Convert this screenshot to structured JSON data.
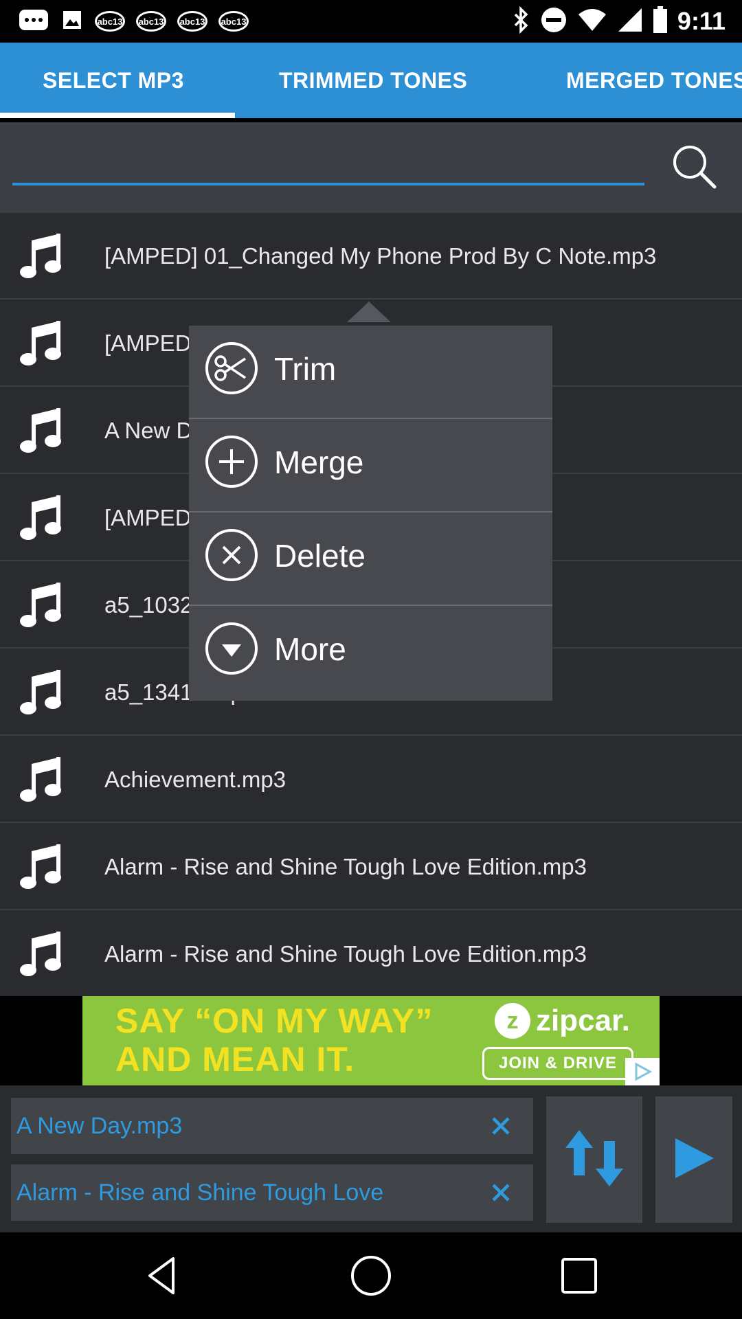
{
  "status_bar": {
    "time": "9:11",
    "channel_badge": "abc13",
    "icons": [
      "messages-icon",
      "photo-icon",
      "channel-icon",
      "bluetooth-icon",
      "dnd-icon",
      "wifi-icon",
      "signal-icon",
      "battery-icon"
    ]
  },
  "tabs": [
    {
      "label": "SELECT MP3",
      "selected": true
    },
    {
      "label": "TRIMMED TONES",
      "selected": false
    },
    {
      "label": "MERGED TONES",
      "selected": false
    }
  ],
  "search": {
    "value": "",
    "placeholder": "",
    "icon": "search-icon"
  },
  "files": [
    {
      "name": "[AMPED] 01_Changed My Phone Prod By C Note.mp3"
    },
    {
      "name": "[AMPED"
    },
    {
      "name": "A New D"
    },
    {
      "name": "[AMPED"
    },
    {
      "name": "a5_1032"
    },
    {
      "name": "a5_13413.mp3"
    },
    {
      "name": "Achievement.mp3"
    },
    {
      "name": "Alarm - Rise and Shine Tough Love Edition.mp3"
    },
    {
      "name": "Alarm - Rise and Shine Tough Love Edition.mp3"
    }
  ],
  "popup_menu": [
    {
      "label": "Trim",
      "icon": "scissors-icon"
    },
    {
      "label": "Merge",
      "icon": "plus-circle-icon"
    },
    {
      "label": "Delete",
      "icon": "close-circle-icon"
    },
    {
      "label": "More",
      "icon": "chevron-down-circle-icon"
    }
  ],
  "ad": {
    "headline_line1": "SAY “ON MY WAY”",
    "headline_line2": "AND MEAN IT.",
    "brand": "zipcar.",
    "cta": "JOIN & DRIVE",
    "colors": {
      "background": "#8cc63f",
      "headline": "#f3e221"
    }
  },
  "selected_tracks": [
    {
      "name": "A New Day.mp3"
    },
    {
      "name": "Alarm - Rise and Shine Tough Love"
    }
  ],
  "colors": {
    "accent": "#2d8fd4",
    "list_background": "#2a2b2f",
    "popup_background": "#47494e"
  }
}
